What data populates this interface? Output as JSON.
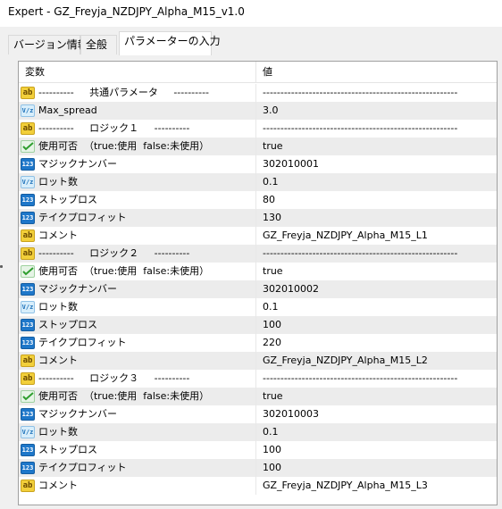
{
  "window": {
    "title": "Expert - GZ_Freyja_NZDJPY_Alpha_M15_v1.0"
  },
  "tabs": [
    {
      "label": "バージョン情報",
      "active": false
    },
    {
      "label": "全般",
      "active": false
    },
    {
      "label": "パラメーターの入力",
      "active": true
    }
  ],
  "grid": {
    "columns": [
      "変数",
      "値"
    ],
    "rows": [
      {
        "icon": "ab",
        "name": "----------     共通パラメータ     ----------",
        "value": "-------------------------------------------------------"
      },
      {
        "icon": "vf",
        "name": "Max_spread",
        "value": "3.0"
      },
      {
        "icon": "ab",
        "name": "----------     ロジック１     ----------",
        "value": "-------------------------------------------------------"
      },
      {
        "icon": "bool",
        "name": "使用可否  （true:使用  false:未使用）",
        "value": "true"
      },
      {
        "icon": "n123",
        "name": "マジックナンバー",
        "value": "302010001"
      },
      {
        "icon": "vf",
        "name": "ロット数",
        "value": "0.1"
      },
      {
        "icon": "n123",
        "name": "ストップロス",
        "value": "80"
      },
      {
        "icon": "n123",
        "name": "テイクプロフィット",
        "value": "130"
      },
      {
        "icon": "ab",
        "name": "コメント",
        "value": "GZ_Freyja_NZDJPY_Alpha_M15_L1"
      },
      {
        "icon": "ab",
        "name": "----------     ロジック２     ----------",
        "value": "-------------------------------------------------------"
      },
      {
        "icon": "bool",
        "name": "使用可否  （true:使用  false:未使用）",
        "value": "true"
      },
      {
        "icon": "n123",
        "name": "マジックナンバー",
        "value": "302010002"
      },
      {
        "icon": "vf",
        "name": "ロット数",
        "value": "0.1"
      },
      {
        "icon": "n123",
        "name": "ストップロス",
        "value": "100"
      },
      {
        "icon": "n123",
        "name": "テイクプロフィット",
        "value": "220"
      },
      {
        "icon": "ab",
        "name": "コメント",
        "value": "GZ_Freyja_NZDJPY_Alpha_M15_L2"
      },
      {
        "icon": "ab",
        "name": "----------     ロジック３     ----------",
        "value": "-------------------------------------------------------"
      },
      {
        "icon": "bool",
        "name": "使用可否  （true:使用  false:未使用）",
        "value": "true"
      },
      {
        "icon": "n123",
        "name": "マジックナンバー",
        "value": "302010003"
      },
      {
        "icon": "vf",
        "name": "ロット数",
        "value": "0.1"
      },
      {
        "icon": "n123",
        "name": "ストップロス",
        "value": "100"
      },
      {
        "icon": "n123",
        "name": "テイクプロフィット",
        "value": "100"
      },
      {
        "icon": "ab",
        "name": "コメント",
        "value": "GZ_Freyja_NZDJPY_Alpha_M15_L3"
      }
    ]
  },
  "icon_glyphs": {
    "ab": "ab",
    "vf": "V/z",
    "n123": "123"
  },
  "colors": {
    "alt_row": "#ececec",
    "string_icon": "#f2cf3a",
    "int_icon": "#1e77c9",
    "double_icon": "#d8eefb",
    "bool_icon_check": "#2e9e2e"
  }
}
